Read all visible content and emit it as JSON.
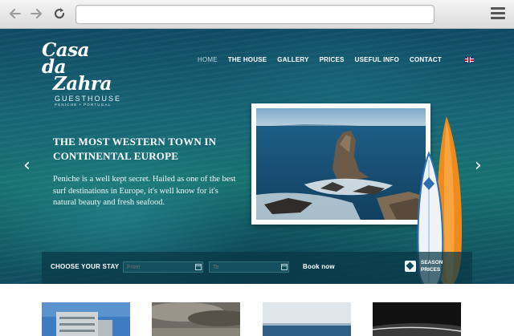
{
  "browser": {
    "url": "",
    "icons": [
      "back-arrow-icon",
      "forward-arrow-icon",
      "reload-icon",
      "hamburger-menu-icon"
    ]
  },
  "logo": {
    "line1": "Casa da",
    "line2": "Zahra",
    "subtitle": "GUESTHOUSE",
    "location": "PENICHE • PORTUGAL"
  },
  "nav": {
    "items": [
      "HOME",
      "THE HOUSE",
      "GALLERY",
      "PRICES",
      "USEFUL INFO",
      "CONTACT"
    ],
    "active": "HOME",
    "language_icon": "uk-flag-icon"
  },
  "hero": {
    "headline_line1": "THE MOST WESTERN TOWN IN",
    "headline_line2": "CONTINENTAL EUROPE",
    "intro": "Peniche is a well kept secret. Hailed as one of the best surf destinations in Europe, it's well know for it's natural beauty and fresh seafood.",
    "prev_arrow": "‹",
    "next_arrow": "›"
  },
  "booking": {
    "label": "CHOOSE YOUR STAY",
    "from_placeholder": "From",
    "to_placeholder": "To",
    "book_label": "Book now",
    "season_line1": "SEASON",
    "season_line2": "PRICES"
  },
  "colors": {
    "ocean_dark": "#0f4a63",
    "ocean_mid": "#17716f",
    "board_orange": "#f08a1c",
    "board_blue": "#2f6fb0",
    "nav_active": "#b9d3d8"
  }
}
